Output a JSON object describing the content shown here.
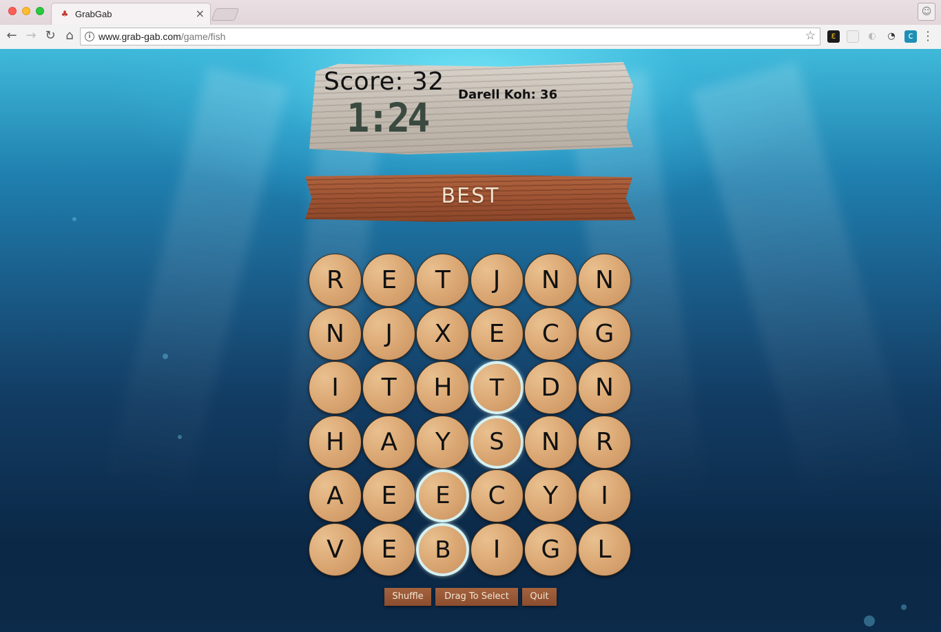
{
  "browser": {
    "tab_title": "GrabGab",
    "tab_close": "×",
    "url_host": "www.grab-gab.com",
    "url_path": "/game/fish",
    "icons": [
      "back-icon",
      "forward-icon",
      "reload-icon",
      "home-icon",
      "info-icon",
      "star-icon",
      "profile-icon",
      "menu-icon"
    ]
  },
  "game": {
    "score_label": "Score: 32",
    "timer": "1:24",
    "opponent": "Darell Koh: 36",
    "current_word": "BEST",
    "grid": [
      [
        "R",
        "E",
        "T",
        "J",
        "N",
        "N"
      ],
      [
        "N",
        "J",
        "X",
        "E",
        "C",
        "G"
      ],
      [
        "I",
        "T",
        "H",
        "T",
        "D",
        "N"
      ],
      [
        "H",
        "A",
        "Y",
        "S",
        "N",
        "R"
      ],
      [
        "A",
        "E",
        "E",
        "C",
        "Y",
        "I"
      ],
      [
        "V",
        "E",
        "B",
        "I",
        "G",
        "L"
      ]
    ],
    "selected": [
      [
        5,
        2
      ],
      [
        4,
        2
      ],
      [
        3,
        3
      ],
      [
        2,
        3
      ]
    ],
    "buttons": {
      "shuffle": "Shuffle",
      "drag": "Drag To Select",
      "quit": "Quit"
    }
  }
}
